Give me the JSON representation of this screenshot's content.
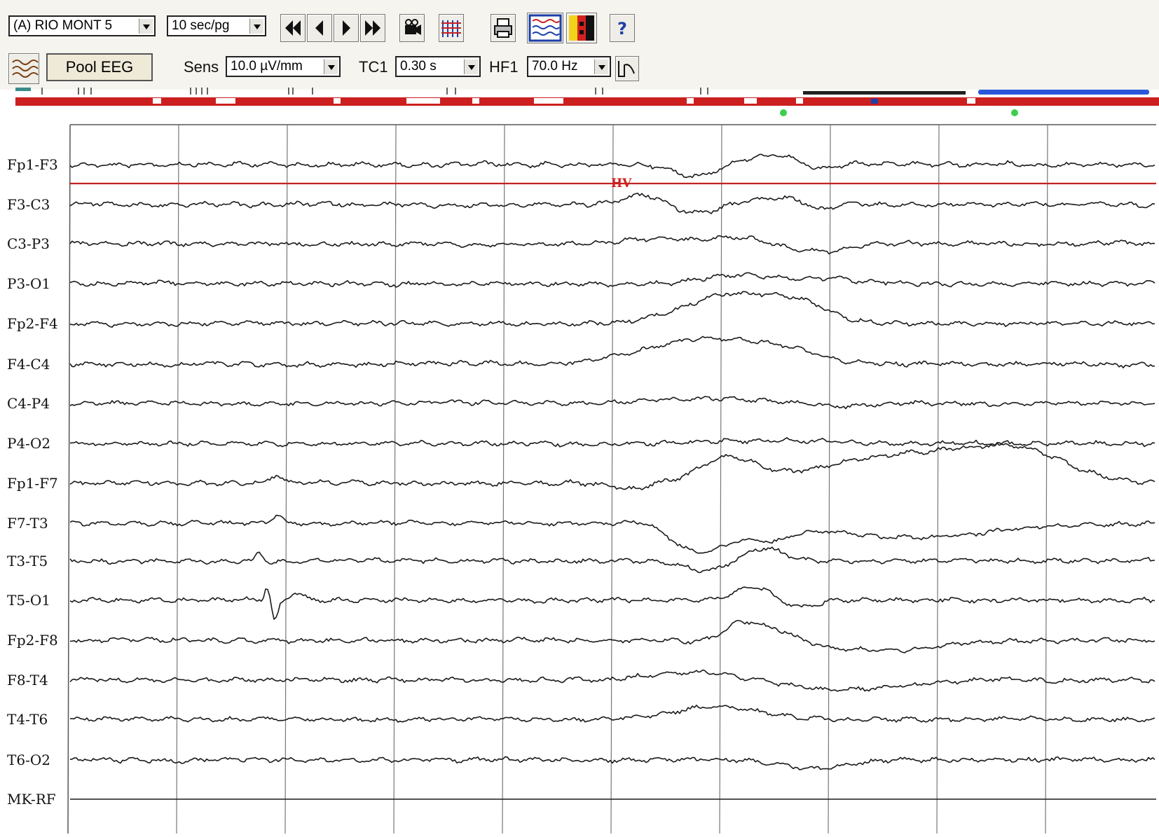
{
  "toolbar": {
    "montage": "(A) RIO MONT 5",
    "page_speed": "10 sec/pg",
    "pool_button": "Pool EEG",
    "sens_label": "Sens",
    "sens_value": "10.0 µV/mm",
    "tc_label": "TC1",
    "tc_value": "0.30 s",
    "hf_label": "HF1",
    "hf_value": "70.0 Hz",
    "icons": [
      "first-page-icon",
      "previous-page-icon",
      "next-page-icon",
      "last-page-icon",
      "video-camera-icon",
      "montage-traces-icon",
      "print-icon",
      "screen-layout-icon",
      "color-palette-icon",
      "help-icon",
      "waves-icon",
      "filter-response-icon"
    ]
  },
  "colors": {
    "trace": "#1a1a1a",
    "timeline": "#cc1f1f",
    "hv_marker": "#c22222",
    "timeline_segment_black": "#222222",
    "timeline_segment_blue": "#2a57d9",
    "timeline_marker_green": "#3ccf4e"
  },
  "channels": [
    "Fp1-F3",
    "F3-C3",
    "C3-P3",
    "P3-O1",
    "Fp2-F4",
    "F4-C4",
    "C4-P4",
    "P4-O2",
    "Fp1-F7",
    "F7-T3",
    "T3-T5",
    "T5-O1",
    "Fp2-F8",
    "F8-T4",
    "T4-T6",
    "T6-O2",
    "MK-RF"
  ],
  "annotation": {
    "hv_label": "HV"
  },
  "epoch_seconds": 10
}
